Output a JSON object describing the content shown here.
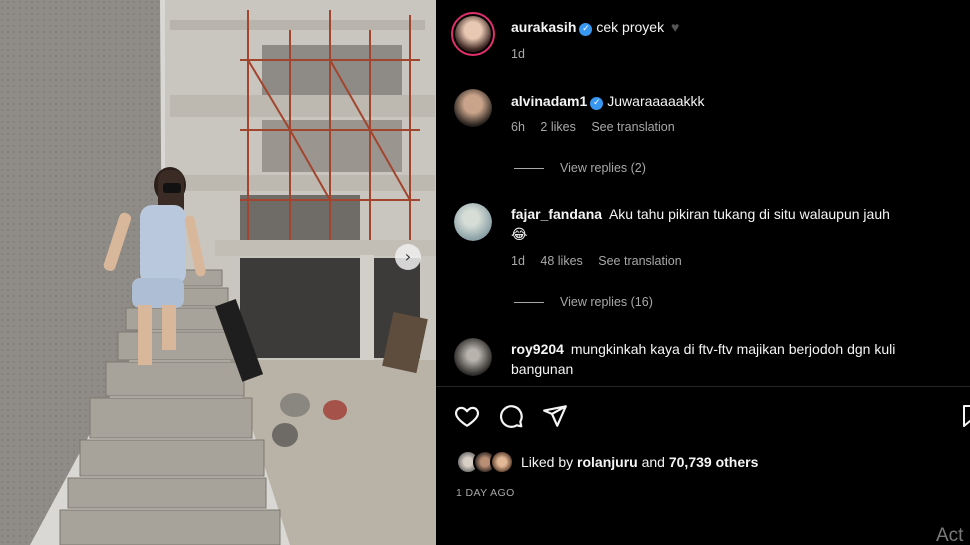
{
  "post": {
    "author": "aurakasih",
    "caption": "cek proyek",
    "caption_emoji": "♥",
    "age": "1d"
  },
  "comments": [
    {
      "username": "alvinadam1",
      "verified": true,
      "text": "Juwaraaaaakkk",
      "text_line2": "",
      "age": "6h",
      "likes": "2 likes",
      "translate": "See translation",
      "replies": "View replies (2)"
    },
    {
      "username": "fajar_fandana",
      "verified": false,
      "text": "Aku tahu pikiran tukang di situ walaupun jauh",
      "text_line2": "😂",
      "age": "1d",
      "likes": "48 likes",
      "translate": "See translation",
      "replies": "View replies (16)"
    },
    {
      "username": "roy9204",
      "verified": false,
      "text": "mungkinkah kaya di ftv-ftv majikan berjodoh dgn kuli",
      "text_line2": "bangunan",
      "age": "",
      "likes": "",
      "translate": "",
      "replies": ""
    }
  ],
  "likes": {
    "prefix": "Liked by",
    "user": "rolanjuru",
    "joiner": "and",
    "count": "70,739 others"
  },
  "timestamp": "1 DAY AGO",
  "watermark": "Act",
  "colors": {
    "background": "#000000",
    "muted": "#a8a8a8",
    "verified": "#3897f0",
    "story_ring": "#e1306c"
  },
  "icons": [
    "heart-icon",
    "comment-icon",
    "share-icon",
    "bookmark-icon",
    "chevron-right-icon",
    "verified-icon"
  ]
}
